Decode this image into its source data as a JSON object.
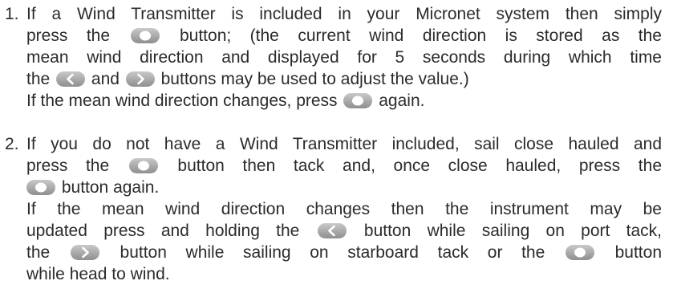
{
  "list": [
    {
      "number": "1.",
      "lines": [
        [
          "If a Wind Transmitter is included in your Micronet system then simply"
        ],
        [
          "press the",
          "button; (the current wind direction is stored as the"
        ],
        [
          "mean wind direction and displayed for 5 seconds during which time"
        ],
        [
          "the",
          "and",
          "buttons may be used to adjust the value.)"
        ],
        [
          "If the mean wind direction changes, press",
          "again."
        ]
      ]
    },
    {
      "number": "2.",
      "lines": [
        [
          "If you do not have a Wind Transmitter included, sail close hauled and"
        ],
        [
          "press the",
          "button then tack and, once close hauled, press the"
        ],
        [
          "button again."
        ],
        [
          "If the mean wind direction changes then the instrument may be"
        ],
        [
          "updated press and holding the",
          "button while sailing on port tack,"
        ],
        [
          "the",
          "button while sailing on starboard tack or the",
          "button"
        ],
        [
          "while head to wind."
        ]
      ]
    }
  ],
  "icons": {
    "center_button": "round-button-icon",
    "left_button": "left-arrow-button-icon",
    "right_button": "right-arrow-button-icon"
  },
  "colors": {
    "text": "#2b2b2b",
    "button_fill": "#9a9a9a",
    "button_symbol": "#ffffff"
  }
}
